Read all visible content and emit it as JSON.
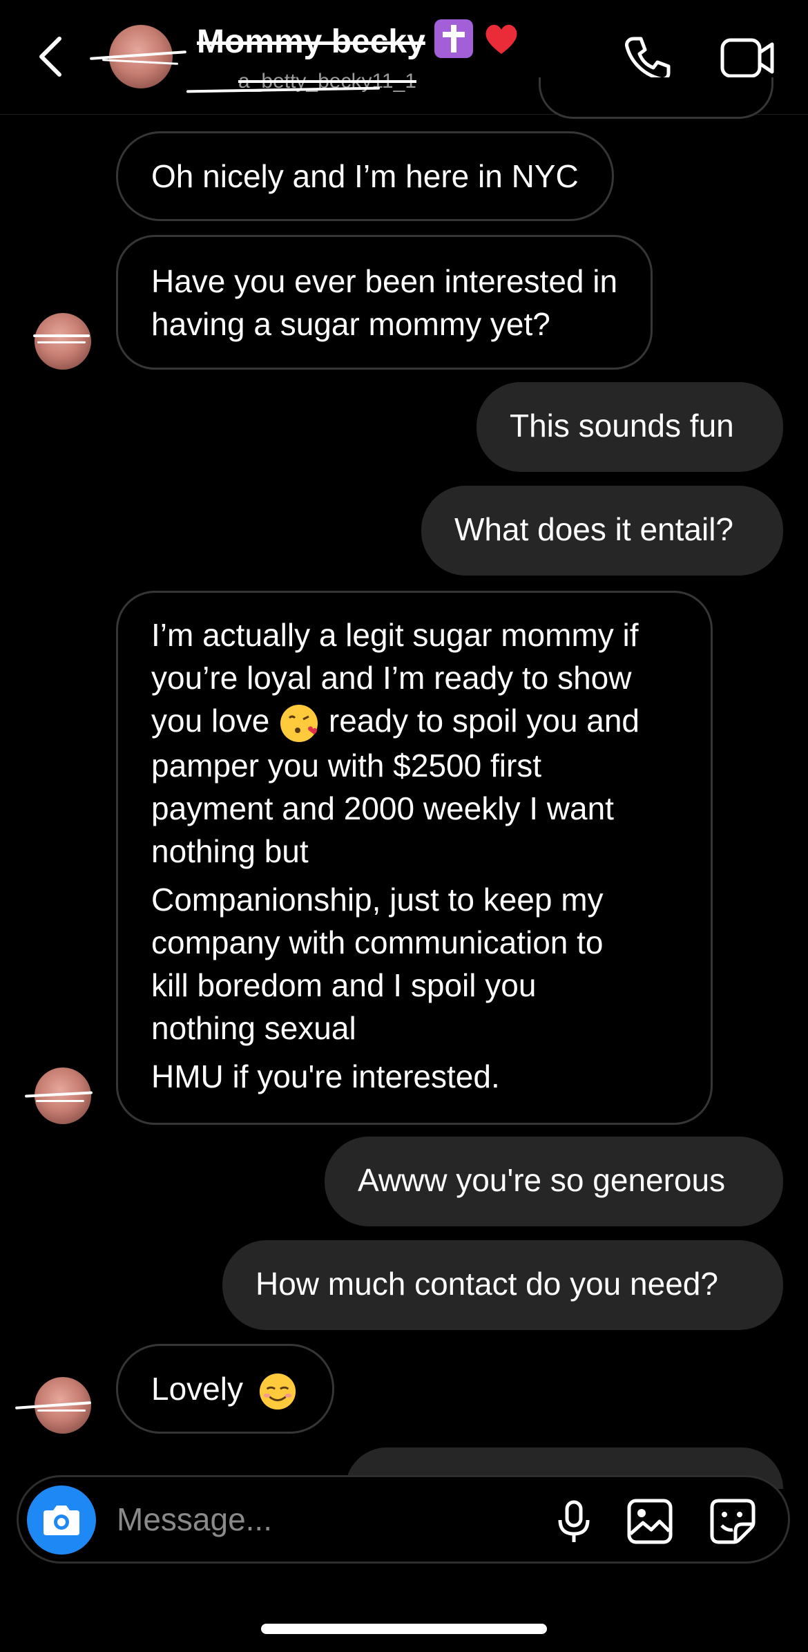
{
  "header": {
    "contact_name": "Mommy becky",
    "contact_username": "a_betty_becky11_1",
    "back_icon": "chevron-left-icon",
    "call_icon": "phone-icon",
    "video_icon": "video-camera-icon"
  },
  "messages": [
    {
      "direction": "incoming",
      "text": "Oh nicely and I’m here in NYC"
    },
    {
      "direction": "incoming",
      "lines": [
        "Have you ever been interested in",
        "having a sugar mommy yet?"
      ]
    },
    {
      "direction": "outgoing",
      "text": "This sounds fun"
    },
    {
      "direction": "outgoing",
      "text": "What does it entail?"
    },
    {
      "direction": "incoming",
      "lines": [
        "I’m actually a legit sugar mommy if",
        "you’re loyal and I’m ready to show",
        "you love",
        "ready to spoil you and",
        "pamper you with $2500 first",
        "payment and 2000 weekly I want",
        "nothing but",
        "Companionship, just to keep my",
        "company with communication to",
        "kill boredom and I spoil you",
        "nothing sexual",
        "HMU if you're interested."
      ]
    },
    {
      "direction": "outgoing",
      "text": "Awww you're so generous"
    },
    {
      "direction": "outgoing",
      "text": "How much contact do you need?"
    },
    {
      "direction": "incoming",
      "text": "Lovely"
    }
  ],
  "composer": {
    "placeholder": "Message...",
    "camera_icon": "camera-icon",
    "mic_icon": "microphone-icon",
    "gallery_icon": "image-icon",
    "sticker_icon": "sticker-icon"
  },
  "colors": {
    "background": "#000000",
    "outgoing_bubble": "#262626",
    "incoming_border": "#363636",
    "camera_button": "#1e88f4"
  }
}
